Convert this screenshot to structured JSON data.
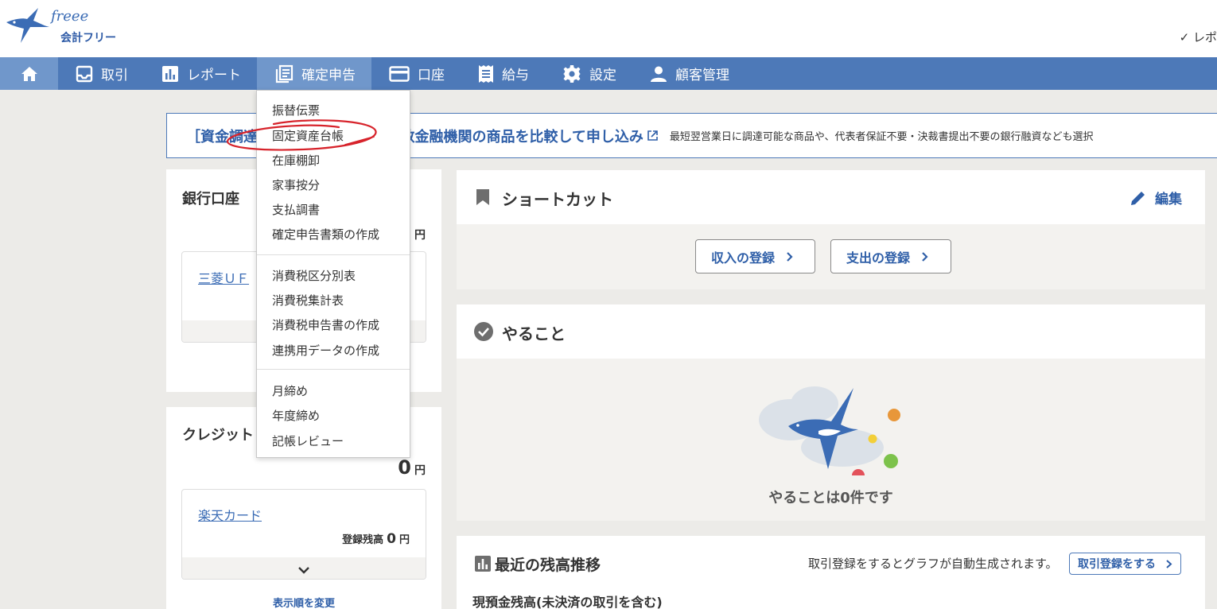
{
  "header": {
    "logo_word": "freee",
    "logo_sub": "会計フリー",
    "report_link": "✓ レポ"
  },
  "nav": {
    "items": [
      {
        "label": "取引"
      },
      {
        "label": "レポート"
      },
      {
        "label": "確定申告"
      },
      {
        "label": "口座"
      },
      {
        "label": "給与"
      },
      {
        "label": "設定"
      },
      {
        "label": "顧客管理"
      }
    ],
    "active": "確定申告"
  },
  "dropdown": {
    "group1": [
      "振替伝票",
      "固定資産台帳",
      "在庫棚卸",
      "家事按分",
      "支払調書",
      "確定申告書類の作成"
    ],
    "group2": [
      "消費税区分別表",
      "消費税集計表",
      "消費税申告書の作成",
      "連携用データの作成"
    ],
    "group3": [
      "月締め",
      "年度締め",
      "記帳レビュー"
    ],
    "highlighted": "固定資産台帳"
  },
  "banner": {
    "main_prefix": "［資金調達",
    "main": "も、複数金融機関の商品を比較して申し込み",
    "sub": "最短翌営業日に調達可能な商品や、代表者保証不要・決裁書提出不要の銀行融資なども選択"
  },
  "bank": {
    "title": "銀行口座",
    "total_unit": "円",
    "account_label": "三菱ＵＦ",
    "account_suffix": "..."
  },
  "credit": {
    "title": "クレジット",
    "total": "0",
    "total_unit": "円",
    "account_label": "楽天カード",
    "balance_label": "登録残高",
    "balance": "0",
    "balance_unit": "円",
    "order_link": "表示順を変更"
  },
  "shortcut": {
    "title": "ショートカット",
    "edit": "編集",
    "income_button": "収入の登録",
    "expense_button": "支出の登録"
  },
  "todo": {
    "title": "やること",
    "empty": "やることは0件です"
  },
  "trend": {
    "title": "最近の残高推移",
    "note": "取引登録をするとグラフが自動生成されます。",
    "button": "取引登録をする",
    "subtitle": "現預金残高(未決済の取引を含む)"
  },
  "colors": {
    "brand": "#4d79b8",
    "nav_active": "#7097cb",
    "link": "#2f5fa8",
    "annotation": "#d7232b"
  }
}
